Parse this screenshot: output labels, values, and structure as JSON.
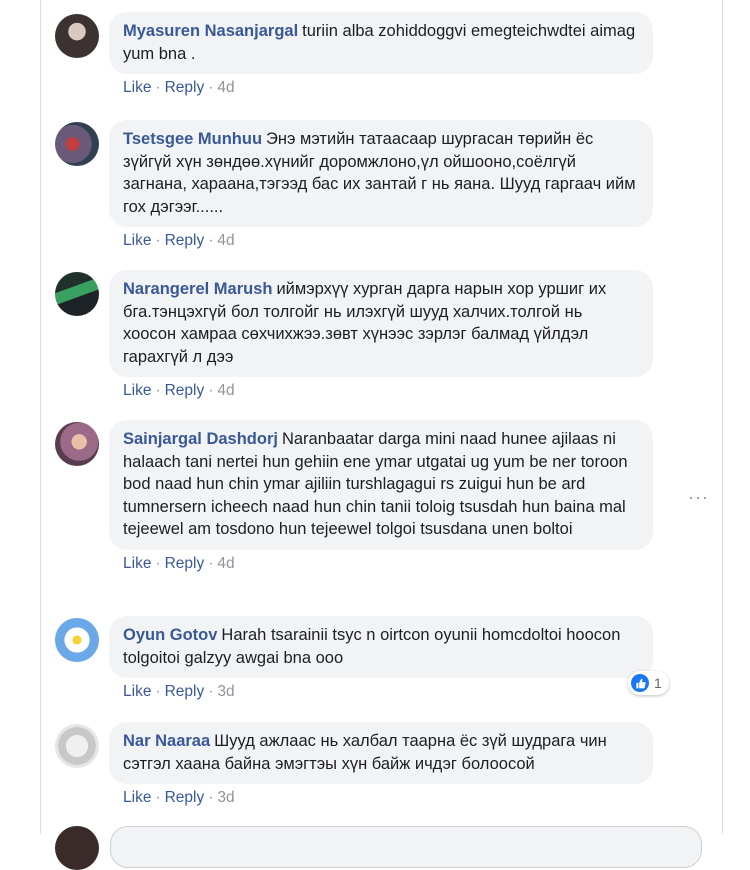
{
  "colors": {
    "link": "#385898",
    "bubble": "#f2f3f5",
    "meta": "#90949c",
    "reaction_blue": "#1877f2"
  },
  "comments": [
    {
      "author": "Myasuren Nasanjargal",
      "text": "turiin alba zohiddoggvi emegteichwdtei aimag yum bna .",
      "like": "Like",
      "reply": "Reply",
      "time": "4d"
    },
    {
      "author": "Tsetsgee Munhuu",
      "text": "Энэ мэтийн татаасаар шургасан төрийн ёс зүйгүй хүн зөндөө.хүнийг доромжлоно,үл ойшооно,соёлгүй загнана, хараана,тэгээд бас их зантай г нь яана. Шууд гаргаач ийм гох дэгээг......",
      "like": "Like",
      "reply": "Reply",
      "time": "4d"
    },
    {
      "author": "Narangerel Marush",
      "text": "иймэрхүү хурган дарга нарын хор уршиг их бга.тэнцэхгүй бол толгойг нь илэхгүй шууд халчих.толгой нь хоосон хамраа сөхчихжээ.зөвт хүнээс зэрлэг балмад үйлдэл гарахгүй л дээ",
      "like": "Like",
      "reply": "Reply",
      "time": "4d"
    },
    {
      "author": "Sainjargal Dashdorj",
      "text": "Naranbaatar darga mini naad hunee ajilaas ni halaach tani nertei hun gehiin ene ymar utgatai ug yum be ner toroon bod naad hun chin ymar ajiliin turshlagagui rs zuigui hun be ard tumnersern icheech naad hun chin tanii toloig tsusdah hun baina mal tejeewel am tosdono hun tejeewel tolgoi tsusdana unen boltoi",
      "like": "Like",
      "reply": "Reply",
      "time": "4d"
    },
    {
      "author": "Oyun Gotov",
      "text": "Harah tsarainii tsyc n oirtcon oyunii homcdoltoi hoocon tolgoitoi galzyy awgai bna ooo",
      "like": "Like",
      "reply": "Reply",
      "time": "3d"
    },
    {
      "author": "Nar Naaraa",
      "text": "Шууд ажлаас нь халбал таарна ёс зүй шудрага чин сэтгэл хаана байна эмэгтэы хүн байж ичдэг болоосой",
      "like": "Like",
      "reply": "Reply",
      "time": "3d"
    }
  ],
  "reaction": {
    "icon": "like-icon",
    "count": "1"
  },
  "more_menu": {
    "icon": "more-options-icon",
    "glyph": "···"
  }
}
